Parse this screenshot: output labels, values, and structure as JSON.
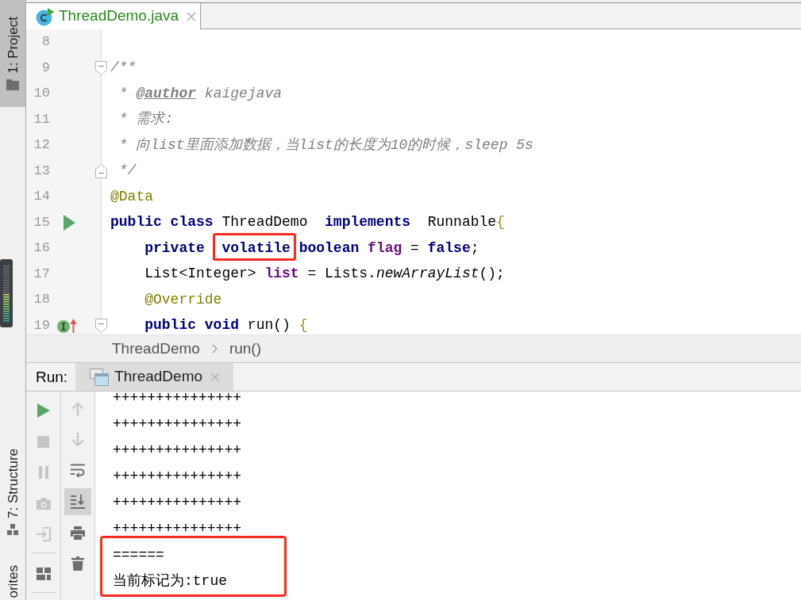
{
  "left_strip": {
    "top": [
      {
        "label": "1: Project",
        "kind": "project",
        "selected": true
      }
    ],
    "bottom": [
      {
        "label": "7: Structure",
        "kind": "structure",
        "selected": false
      },
      {
        "label": "orites",
        "kind": "favorites",
        "selected": false
      }
    ]
  },
  "editor_tabs": [
    {
      "label": "ThreadDemo.java",
      "selected": true
    }
  ],
  "editor": {
    "lines": [
      {
        "number": "8"
      },
      {
        "number": "9",
        "fold": {
          "kind": "start"
        },
        "tokens": [
          {
            "text": "/**",
            "kind": "comment"
          }
        ]
      },
      {
        "number": "10",
        "tokens": [
          {
            "text": " * ",
            "kind": "comment"
          },
          {
            "text": "@author",
            "kind": "doctag"
          },
          {
            "text": " kaigejava",
            "kind": "comment"
          }
        ]
      },
      {
        "number": "11",
        "tokens": [
          {
            "text": " * 需求:",
            "kind": "comment"
          }
        ]
      },
      {
        "number": "12",
        "tokens": [
          {
            "text": " * 向list里面添加数据，当list的长度为10的时候，sleep 5s",
            "kind": "comment"
          }
        ]
      },
      {
        "number": "13",
        "fold": {
          "kind": "end"
        },
        "tokens": [
          {
            "text": " */",
            "kind": "comment"
          }
        ]
      },
      {
        "number": "14",
        "tokens": [
          {
            "text": "@Data",
            "kind": "annotation"
          }
        ]
      },
      {
        "number": "15",
        "marker": {
          "kind": "run"
        },
        "tokens": [
          {
            "text": "public class ",
            "kind": "keyword"
          },
          {
            "text": "ThreadDemo  ",
            "kind": "plain"
          },
          {
            "text": "implements  ",
            "kind": "keyword"
          },
          {
            "text": "Runnable",
            "kind": "plain"
          },
          {
            "text": "{",
            "kind": "brace"
          }
        ]
      },
      {
        "number": "16",
        "tokens": [
          {
            "text": "    private  ",
            "kind": "keyword"
          },
          {
            "text": "volatile",
            "kind": "keyword",
            "frame": {
              "kind": "box"
            }
          },
          {
            "text": " boolean ",
            "kind": "keyword"
          },
          {
            "text": "flag",
            "kind": "field"
          },
          {
            "text": " = ",
            "kind": "plain"
          },
          {
            "text": "false",
            "kind": "keyword"
          },
          {
            "text": ";",
            "kind": "plain"
          }
        ]
      },
      {
        "number": "17",
        "tokens": [
          {
            "text": "    List<Integer> ",
            "kind": "plain"
          },
          {
            "text": "list",
            "kind": "field"
          },
          {
            "text": " = Lists.",
            "kind": "plain"
          },
          {
            "text": "newArrayList",
            "kind": "method"
          },
          {
            "text": "();",
            "kind": "plain"
          }
        ]
      },
      {
        "number": "18",
        "tokens": [
          {
            "text": "    @Override",
            "kind": "annotation"
          }
        ]
      },
      {
        "number": "19",
        "marker": {
          "kind": "implements"
        },
        "fold": {
          "kind": "start"
        },
        "tokens": [
          {
            "text": "    public void ",
            "kind": "keyword"
          },
          {
            "text": "run() ",
            "kind": "plain"
          },
          {
            "text": "{",
            "kind": "brace"
          }
        ]
      }
    ]
  },
  "breadcrumbs": [
    "ThreadDemo",
    "run()"
  ],
  "run_panel": {
    "label": "Run:",
    "tabs": [
      {
        "label": "ThreadDemo",
        "selected": true
      }
    ],
    "run_toolbar": [
      {
        "kind": "rerun",
        "disabled": false
      },
      {
        "kind": "stop",
        "disabled": true
      },
      {
        "kind": "pause",
        "disabled": true
      },
      {
        "kind": "dump",
        "disabled": true
      },
      {
        "kind": "exit",
        "disabled": true
      },
      {
        "kind": "separator"
      },
      {
        "kind": "layout",
        "disabled": false
      },
      {
        "kind": "separator"
      }
    ],
    "console_toolbar": [
      {
        "kind": "up",
        "disabled": true,
        "selected": false
      },
      {
        "kind": "down",
        "disabled": true,
        "selected": false
      },
      {
        "kind": "wrap",
        "disabled": false,
        "selected": false
      },
      {
        "kind": "autoscroll",
        "disabled": false,
        "selected": true
      },
      {
        "kind": "print",
        "disabled": false,
        "selected": false
      },
      {
        "kind": "clear",
        "disabled": false,
        "selected": false
      }
    ],
    "console": {
      "lines": [
        {
          "text": "+++++++++++++++",
          "highlighted": false
        },
        {
          "text": "+++++++++++++++",
          "highlighted": false
        },
        {
          "text": "+++++++++++++++",
          "highlighted": false
        },
        {
          "text": "+++++++++++++++",
          "highlighted": false
        },
        {
          "text": "+++++++++++++++",
          "highlighted": false
        },
        {
          "text": "+++++++++++++++",
          "highlighted": false
        },
        {
          "text": "======",
          "highlighted": true
        },
        {
          "text": "当前标记为:true",
          "highlighted": true
        }
      ]
    }
  }
}
